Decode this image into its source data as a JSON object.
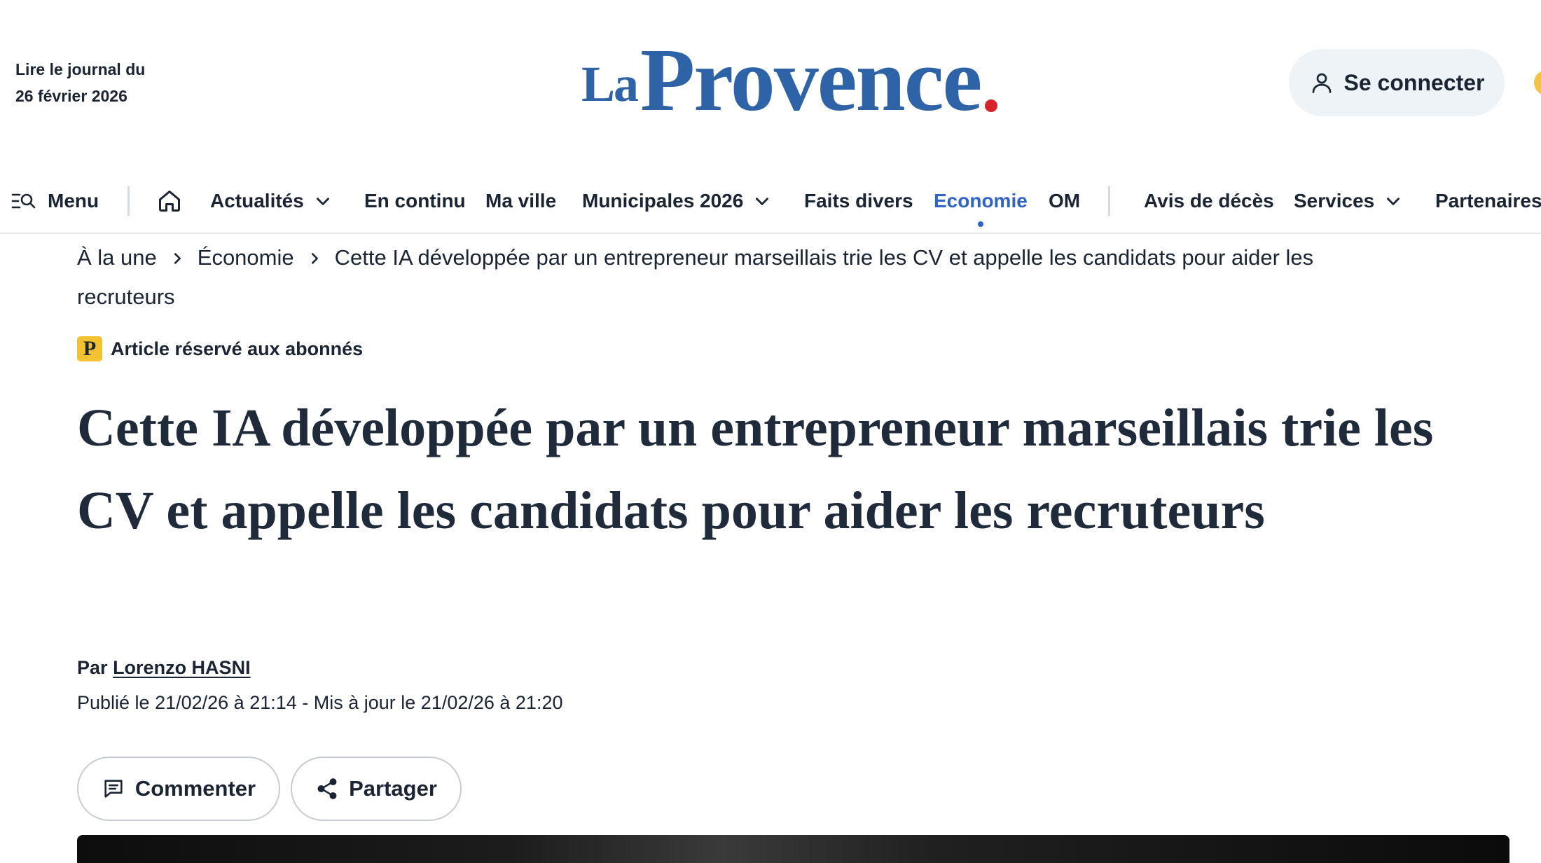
{
  "header": {
    "read_journal_line1": "Lire le journal du",
    "read_journal_line2": "26 février 2026",
    "logo_la": "La",
    "logo_provence": "Provence",
    "login_label": "Se connecter"
  },
  "nav": {
    "menu_label": "Menu",
    "items": [
      {
        "label": "Actualités"
      },
      {
        "label": "En continu"
      },
      {
        "label": "Ma ville"
      },
      {
        "label": "Municipales 2026"
      },
      {
        "label": "Faits divers"
      },
      {
        "label": "Economie"
      },
      {
        "label": "OM"
      },
      {
        "label": "Avis de décès"
      },
      {
        "label": "Services"
      },
      {
        "label": "Partenaires"
      }
    ]
  },
  "breadcrumb": {
    "items": [
      {
        "label": "À la une"
      },
      {
        "label": "Économie"
      },
      {
        "label": "Cette IA développée par un entrepreneur marseillais trie les CV et appelle les candidats pour aider les recruteurs"
      }
    ]
  },
  "article": {
    "premium_label": "Article réservé aux abonnés",
    "premium_icon_letter": "P",
    "title": "Cette IA développée par un entrepreneur marseillais trie les CV et appelle les candidats pour aider les recruteurs",
    "by_prefix": "Par",
    "author": "Lorenzo HASNI",
    "dates": "Publié le 21/02/26 à 21:14 - Mis à jour le 21/02/26 à 21:20"
  },
  "actions": {
    "comment_label": "Commenter",
    "share_label": "Partager"
  },
  "colors": {
    "brand_blue": "#2f63a8",
    "logo_dot_red": "#d8232a",
    "active_nav": "#2f63c8",
    "premium_yellow": "#f2c230"
  }
}
